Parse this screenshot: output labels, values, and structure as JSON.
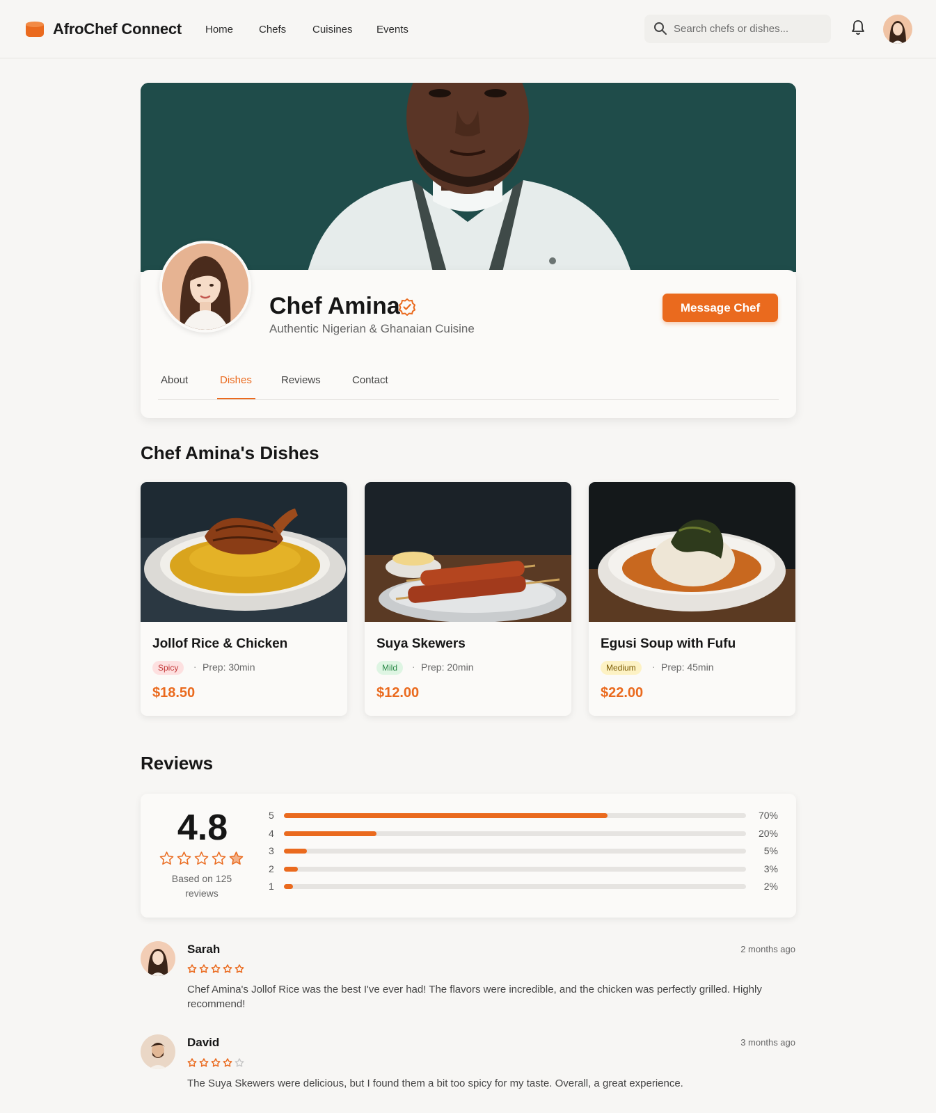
{
  "nav": {
    "brand": "AfroChef Connect",
    "links": [
      "Home",
      "Chefs",
      "Cuisines",
      "Events"
    ],
    "search_placeholder": "Search chefs or dishes...",
    "colors": {
      "accent": "#ea6a1e"
    }
  },
  "profile": {
    "name": "Chef Amina",
    "subtitle": "Authentic Nigerian & Ghanaian Cuisine",
    "message_button": "Message Chef",
    "tabs": [
      "About",
      "Dishes",
      "Reviews",
      "Contact"
    ],
    "active_tab": "Dishes"
  },
  "dishes_section": {
    "title": "Chef Amina's Dishes",
    "items": [
      {
        "name": "Jollof Rice & Chicken",
        "tag": "Spicy",
        "tag_color": "#fde0e0",
        "tag_text_color": "#c33a3a",
        "prep": "Prep: 30min",
        "price": "$18.50"
      },
      {
        "name": "Suya Skewers",
        "tag": "Mild",
        "tag_color": "#def5e3",
        "tag_text_color": "#2e8a4a",
        "prep": "Prep: 20min",
        "price": "$12.00"
      },
      {
        "name": "Egusi Soup with Fufu",
        "tag": "Medium",
        "tag_color": "#fdf2c4",
        "tag_text_color": "#7a5a00",
        "prep": "Prep: 45min",
        "price": "$22.00"
      }
    ]
  },
  "reviews_section": {
    "title": "Reviews",
    "average": "4.8",
    "average_value": 4.8,
    "based_on": "Based on 125 reviews",
    "distribution": [
      {
        "label": "5",
        "pct_text": "70%",
        "pct": 70
      },
      {
        "label": "4",
        "pct_text": "20%",
        "pct": 20
      },
      {
        "label": "3",
        "pct_text": "5%",
        "pct": 5
      },
      {
        "label": "2",
        "pct_text": "3%",
        "pct": 3
      },
      {
        "label": "1",
        "pct_text": "2%",
        "pct": 2
      }
    ],
    "reviews": [
      {
        "name": "Sarah",
        "time": "2 months ago",
        "rating": 5,
        "text": "Chef Amina's Jollof Rice was the best I've ever had! The flavors were incredible, and the chicken was perfectly grilled. Highly recommend!"
      },
      {
        "name": "David",
        "time": "3 months ago",
        "rating": 4,
        "text": "The Suya Skewers were delicious, but I found them a bit too spicy for my taste. Overall, a great experience."
      }
    ]
  }
}
